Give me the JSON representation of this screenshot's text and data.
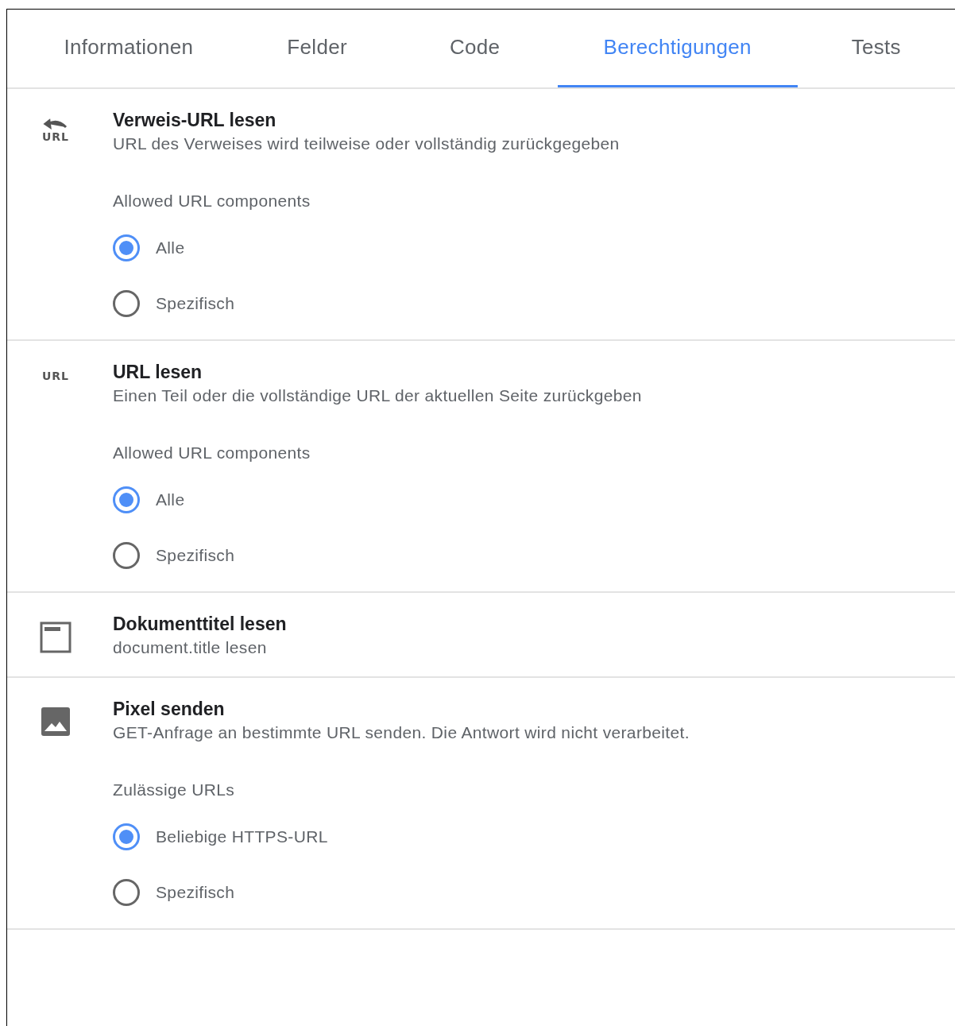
{
  "tabs": [
    {
      "label": "Informationen",
      "selected": false
    },
    {
      "label": "Felder",
      "selected": false
    },
    {
      "label": "Code",
      "selected": false
    },
    {
      "label": "Berechtigungen",
      "selected": true
    },
    {
      "label": "Tests",
      "selected": false
    }
  ],
  "permissions": [
    {
      "icon": {
        "kind": "referrer",
        "text": "URL"
      },
      "title": "Verweis-URL lesen",
      "description": "URL des Verweises wird teilweise oder vollständig zurückgegeben",
      "options_label": "Allowed URL components",
      "options": [
        {
          "label": "Alle",
          "selected": true
        },
        {
          "label": "Spezifisch",
          "selected": false
        }
      ]
    },
    {
      "icon": {
        "kind": "url",
        "text": "URL"
      },
      "title": "URL lesen",
      "description": "Einen Teil oder die vollständige URL der aktuellen Seite zurückgeben",
      "options_label": "Allowed URL components",
      "options": [
        {
          "label": "Alle",
          "selected": true
        },
        {
          "label": "Spezifisch",
          "selected": false
        }
      ]
    },
    {
      "icon": {
        "kind": "title"
      },
      "title": "Dokumenttitel lesen",
      "description": "document.title lesen"
    },
    {
      "icon": {
        "kind": "image"
      },
      "title": "Pixel senden",
      "description": "GET-Anfrage an bestimmte URL senden. Die Antwort wird nicht verarbeitet.",
      "options_label": "Zulässige URLs",
      "options": [
        {
          "label": "Beliebige HTTPS-URL",
          "selected": true
        },
        {
          "label": "Spezifisch",
          "selected": false
        }
      ]
    }
  ]
}
